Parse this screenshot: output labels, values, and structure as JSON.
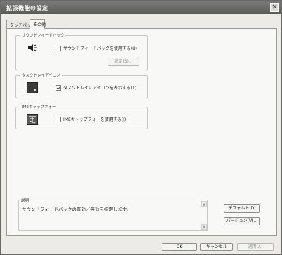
{
  "window": {
    "title": "拡張機能の設定",
    "close_symbol": "✕"
  },
  "tabs": [
    {
      "label": "タッチパッド",
      "active": false
    },
    {
      "label": "その他",
      "active": true
    }
  ],
  "groups": {
    "sound": {
      "title": "サウンドフィードバック",
      "checkbox_label": "サウンドフィードバックを使用する(U)",
      "checked": false,
      "settings_button": "設定(S)..."
    },
    "tasktray": {
      "title": "タスクトレイアイコン",
      "checkbox_label": "タスクトレイにアイコンを表示する(T)",
      "checked": true
    },
    "ime": {
      "title": "IMEキャップフォー",
      "checkbox_label": "IMEキャップフォーを使用する(I)",
      "checked": false
    }
  },
  "description": {
    "title": "説明",
    "text": "サウンドフィードバックの有効／無効を指定します。"
  },
  "side_buttons": {
    "default": "デフォルト(D)",
    "version": "バージョン(V)..."
  },
  "footer": {
    "ok": "OK",
    "cancel": "キャンセル",
    "apply": "適用(A)"
  }
}
